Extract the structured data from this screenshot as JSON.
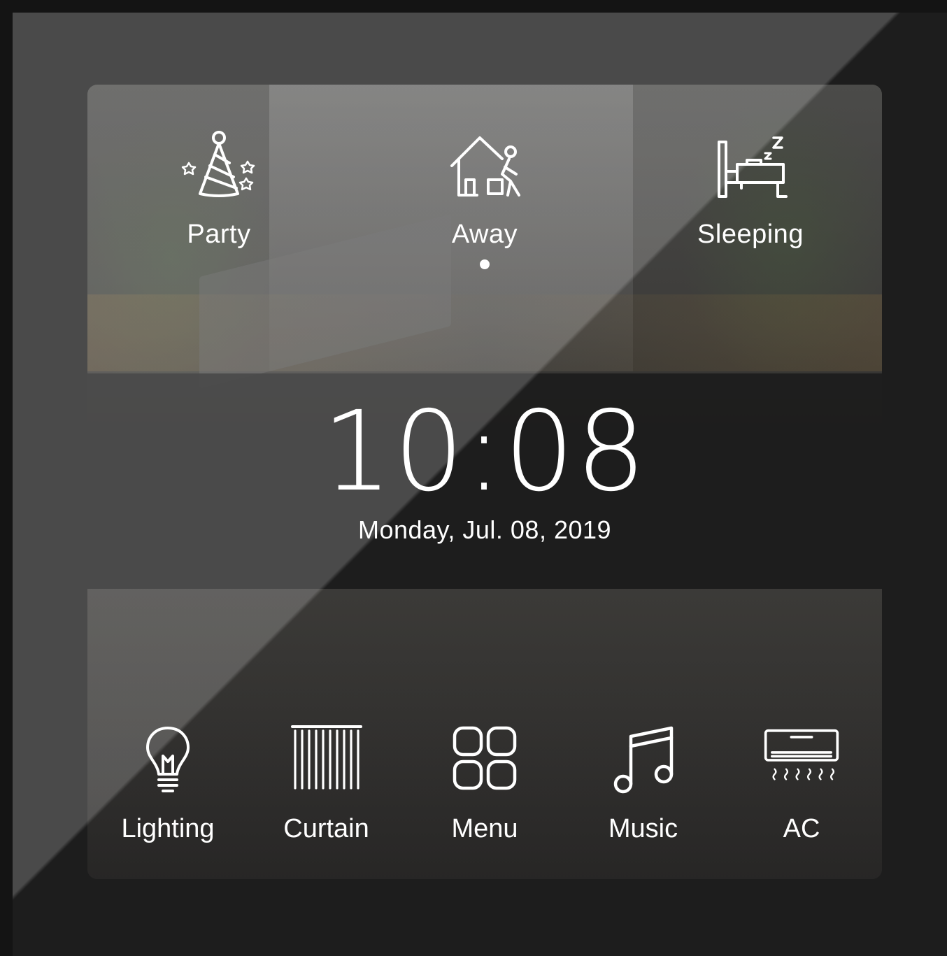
{
  "scenes": [
    {
      "label": "Party",
      "icon": "party-hat-icon",
      "active": false
    },
    {
      "label": "Away",
      "icon": "leaving-home-icon",
      "active": true
    },
    {
      "label": "Sleeping",
      "icon": "bed-icon",
      "active": false
    }
  ],
  "clock": {
    "time": "10:08",
    "date": "Monday, Jul. 08, 2019"
  },
  "apps": [
    {
      "label": "Lighting",
      "icon": "light-bulb-icon"
    },
    {
      "label": "Curtain",
      "icon": "curtain-icon"
    },
    {
      "label": "Menu",
      "icon": "grid-menu-icon"
    },
    {
      "label": "Music",
      "icon": "music-note-icon"
    },
    {
      "label": "AC",
      "icon": "air-conditioner-icon"
    }
  ],
  "colors": {
    "text": "#ffffff",
    "background": "#1d1d1d",
    "band": "#1c1c1c"
  }
}
